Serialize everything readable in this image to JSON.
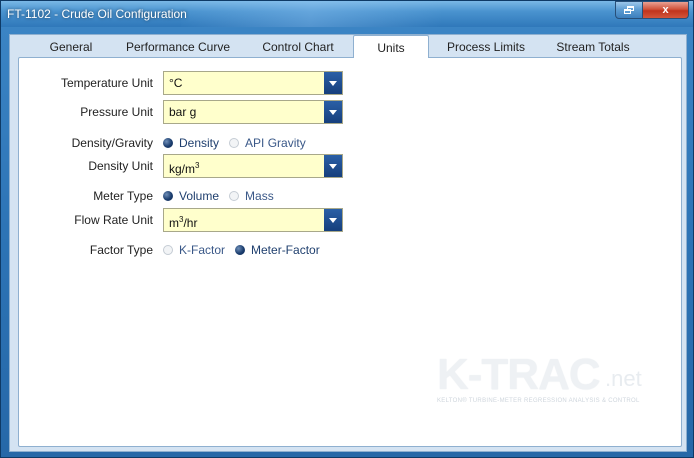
{
  "window": {
    "title": "FT-1102 - Crude Oil Configuration",
    "restore_glyph": "restore-icon",
    "close_glyph": "x"
  },
  "tabs": [
    {
      "label": "General"
    },
    {
      "label": "Performance Curve"
    },
    {
      "label": "Control Chart"
    },
    {
      "label": "Units",
      "active": true
    },
    {
      "label": "Process Limits"
    },
    {
      "label": "Stream Totals"
    }
  ],
  "form": {
    "temperature": {
      "label": "Temperature Unit",
      "value": "°C"
    },
    "pressure": {
      "label": "Pressure Unit",
      "value": "bar g"
    },
    "density_gravity": {
      "label": "Density/Gravity",
      "options": [
        {
          "label": "Density",
          "selected": true
        },
        {
          "label": "API Gravity",
          "selected": false
        }
      ]
    },
    "density_unit": {
      "label": "Density Unit",
      "value": "kg/m",
      "sup": "3"
    },
    "meter_type": {
      "label": "Meter Type",
      "options": [
        {
          "label": "Volume",
          "selected": true
        },
        {
          "label": "Mass",
          "selected": false
        }
      ]
    },
    "flow_rate": {
      "label": "Flow Rate Unit",
      "value_pre": "m",
      "sup": "3",
      "value_post": "/hr"
    },
    "factor_type": {
      "label": "Factor Type",
      "options": [
        {
          "label": "K-Factor",
          "selected": false
        },
        {
          "label": "Meter-Factor",
          "selected": true
        }
      ]
    }
  },
  "logo": {
    "main": "K-TRAC",
    "suffix": ".net",
    "subtitle": "KELTON® TURBINE-METER REGRESSION ANALYSIS & CONTROL"
  },
  "colors": {
    "field_bg": "#ffffcc",
    "dropdown_button": "#1d4c8f",
    "radio_selected": "#1b3d6e",
    "window_frame": "#2d74b6"
  }
}
